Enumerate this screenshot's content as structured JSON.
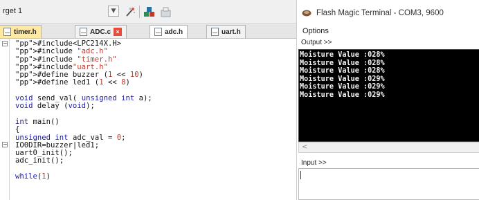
{
  "ide": {
    "target_label": "rget 1",
    "tabs": [
      {
        "label": "timer.h",
        "style": "yellow"
      },
      {
        "label": "ADC.c",
        "style": "normal"
      },
      {
        "label": "adc.h",
        "style": "active"
      },
      {
        "label": "uart.h",
        "style": "normal"
      }
    ],
    "code": [
      "#include<LPC214X.H>",
      "#include \"adc.h\"",
      "#include \"timer.h\"",
      "#include\"uart.h\"",
      "#define buzzer (1 << 10)",
      "#define led1 (1 << 8)",
      "",
      "void send_val( unsigned int a);",
      "void delay (void);",
      "",
      "int main()",
      "{",
      "unsigned int adc_val = 0;",
      "IO0DIR=buzzer|led1;",
      "uart0_init();",
      "adc_init();",
      "",
      "while(1)"
    ]
  },
  "terminal": {
    "title": "Flash Magic Terminal - COM3, 9600",
    "menu_options": "Options",
    "output_label": "Output >>",
    "input_label": "Input >>",
    "output_lines": [
      "Moisture Value :028%",
      "Moisture Value :028%",
      "Moisture Value :028%",
      "Moisture Value :029%",
      "Moisture Value :029%",
      "Moisture Value :029%"
    ],
    "input_value": ""
  },
  "colors": {
    "terminal_bg": "#000000",
    "terminal_fg": "#f4f4f4",
    "keyword": "#1a1aa6",
    "string": "#c0392b"
  }
}
